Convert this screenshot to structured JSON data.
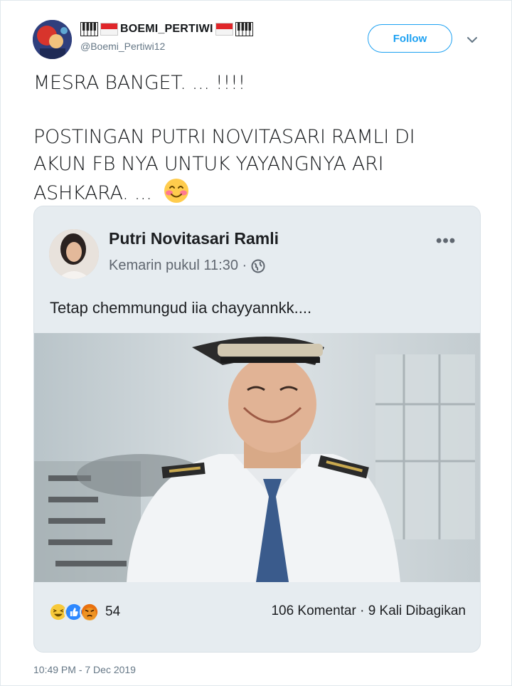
{
  "tweet": {
    "display_name": "BOEMI_PERTIWI",
    "handle": "@Boemi_Pertiwi12",
    "follow_label": "Follow",
    "text_line1": "MESRA BANGET. ... !!!!",
    "text_line2": "POSTINGAN PUTRI NOVITASARI RAMLI DI",
    "text_line3": "AKUN FB NYA UNTUK YAYANGNYA ARI",
    "text_line4": "ASHKARA. ...",
    "timestamp": "10:49 PM - 7 Dec 2019"
  },
  "fb_post": {
    "author": "Putri Novitasari Ramli",
    "time": "Kemarin pukul 11:30 ·",
    "more": "•••",
    "caption": "Tetap chemmungud iia chayyannkk....",
    "reaction_count": "54",
    "stats": "106 Komentar · 9 Kali Dibagikan"
  },
  "icons": {
    "chevron": "chevron-down-icon",
    "globe": "globe-icon",
    "emoji": "smiling-face-icon",
    "reactions": [
      "haha-reaction-icon",
      "like-reaction-icon",
      "angry-reaction-icon"
    ]
  },
  "colors": {
    "accent": "#1da1f2",
    "card_bg": "#e6ecf0",
    "muted": "#657786"
  }
}
